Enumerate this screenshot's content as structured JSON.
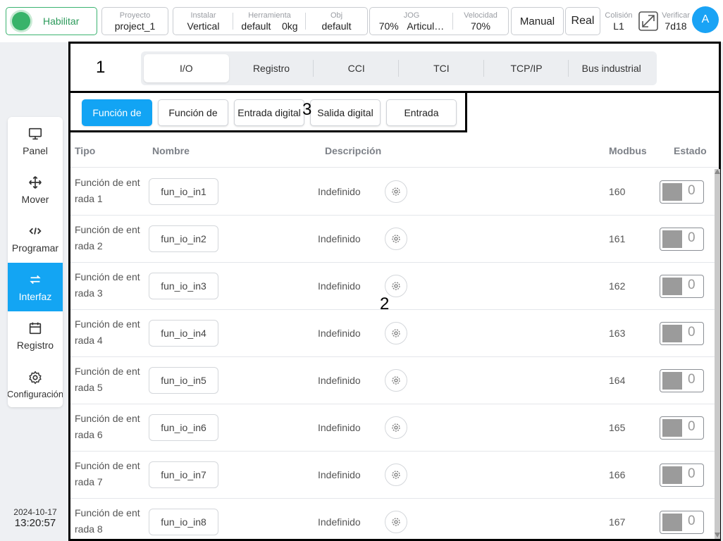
{
  "topbar": {
    "enable_label": "Habilitar",
    "project": {
      "label": "Proyecto",
      "value": "project_1"
    },
    "install": {
      "label": "Instalar",
      "value": "Vertical"
    },
    "tool": {
      "label": "Herramienta",
      "value_a": "default",
      "value_b": "0kg"
    },
    "obj": {
      "label": "Obj",
      "value": "default"
    },
    "jog": {
      "label": "JOG",
      "value_a": "70%",
      "value_b": "Articul…"
    },
    "speed": {
      "label": "Velocidad",
      "value": "70%"
    },
    "mode": "Manual",
    "real": "Real",
    "collision": {
      "label": "Colisión",
      "value": "L1"
    },
    "verify": {
      "label": "Verificar",
      "value": "7d18"
    },
    "avatar": "A",
    "status_color": "#38b36a",
    "accent_color": "#13a5f3"
  },
  "sidebar": {
    "items": [
      {
        "label": "Panel",
        "icon": "monitor-icon"
      },
      {
        "label": "Mover",
        "icon": "move-arrows-icon"
      },
      {
        "label": "Programar",
        "icon": "code-icon"
      },
      {
        "label": "Interfaz",
        "icon": "swap-icon"
      },
      {
        "label": "Registro",
        "icon": "calendar-icon"
      },
      {
        "label": "Configuración",
        "icon": "gear-icon"
      }
    ],
    "active": "Interfaz",
    "date": "2024-10-17",
    "time": "13:20:57"
  },
  "annotations": {
    "n1": "1",
    "n2": "2",
    "n3": "3"
  },
  "tabs": [
    "I/O",
    "Registro",
    "CCI",
    "TCI",
    "TCP/IP",
    "Bus industrial"
  ],
  "subtabs": [
    "Función de",
    "Función de",
    "Entrada digital",
    "Salida digital",
    "Entrada"
  ],
  "table": {
    "headers": {
      "type": "Tipo",
      "name": "Nombre",
      "desc": "Descripción",
      "modbus": "Modbus",
      "state": "Estado"
    },
    "rows": [
      {
        "type_a": "Función de ent",
        "type_b": "rada 1",
        "name": "fun_io_in1",
        "desc": "Indefinido",
        "modbus": "160",
        "state": "0"
      },
      {
        "type_a": "Función de ent",
        "type_b": "rada 2",
        "name": "fun_io_in2",
        "desc": "Indefinido",
        "modbus": "161",
        "state": "0"
      },
      {
        "type_a": "Función de ent",
        "type_b": "rada 3",
        "name": "fun_io_in3",
        "desc": "Indefinido",
        "modbus": "162",
        "state": "0"
      },
      {
        "type_a": "Función de ent",
        "type_b": "rada 4",
        "name": "fun_io_in4",
        "desc": "Indefinido",
        "modbus": "163",
        "state": "0"
      },
      {
        "type_a": "Función de ent",
        "type_b": "rada 5",
        "name": "fun_io_in5",
        "desc": "Indefinido",
        "modbus": "164",
        "state": "0"
      },
      {
        "type_a": "Función de ent",
        "type_b": "rada 6",
        "name": "fun_io_in6",
        "desc": "Indefinido",
        "modbus": "165",
        "state": "0"
      },
      {
        "type_a": "Función de ent",
        "type_b": "rada 7",
        "name": "fun_io_in7",
        "desc": "Indefinido",
        "modbus": "166",
        "state": "0"
      },
      {
        "type_a": "Función de ent",
        "type_b": "rada 8",
        "name": "fun_io_in8",
        "desc": "Indefinido",
        "modbus": "167",
        "state": "0"
      }
    ]
  }
}
